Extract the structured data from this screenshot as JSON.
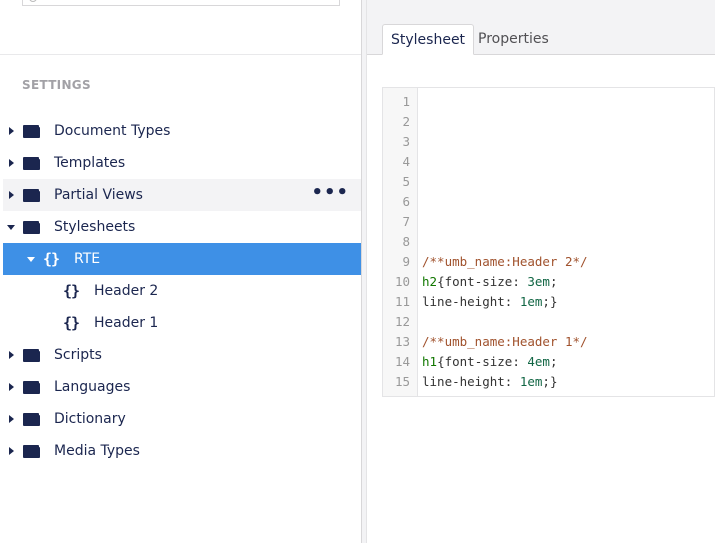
{
  "tree": {
    "section_title": "SETTINGS",
    "items": [
      {
        "label": "Document Types",
        "expand": "collapsed",
        "icon": "folder-icon"
      },
      {
        "label": "Templates",
        "expand": "collapsed",
        "icon": "folder-icon"
      },
      {
        "label": "Partial Views",
        "expand": "collapsed",
        "icon": "folder-icon",
        "hovered": true,
        "actions": "•••"
      },
      {
        "label": "Stylesheets",
        "expand": "expanded",
        "icon": "folder-icon"
      },
      {
        "label": "RTE",
        "expand": "expanded",
        "icon": "braces-icon",
        "selected": true,
        "icon_text": "{}"
      },
      {
        "label": "Header 2",
        "icon": "braces-icon",
        "icon_text": "{}"
      },
      {
        "label": "Header 1",
        "icon": "braces-icon",
        "icon_text": "{}"
      },
      {
        "label": "Scripts",
        "expand": "collapsed",
        "icon": "folder-icon"
      },
      {
        "label": "Languages",
        "expand": "collapsed",
        "icon": "folder-icon"
      },
      {
        "label": "Dictionary",
        "expand": "collapsed",
        "icon": "folder-icon"
      },
      {
        "label": "Media Types",
        "expand": "collapsed",
        "icon": "folder-icon"
      }
    ]
  },
  "editor": {
    "tabs": [
      {
        "label": "Stylesheet",
        "active": true
      },
      {
        "label": "Properties",
        "active": false
      }
    ],
    "lines": [
      {
        "n": "1",
        "text": ""
      },
      {
        "n": "2",
        "text": ""
      },
      {
        "n": "3",
        "text": ""
      },
      {
        "n": "4",
        "text": ""
      },
      {
        "n": "5",
        "text": ""
      },
      {
        "n": "6",
        "text": ""
      },
      {
        "n": "7",
        "text": ""
      },
      {
        "n": "8",
        "text": ""
      },
      {
        "n": "9",
        "comment": "/**umb_name:Header 2*/"
      },
      {
        "n": "10",
        "tag": "h2",
        "rest": "{font-size: ",
        "num": "3em",
        "tail": ";"
      },
      {
        "n": "11",
        "text": "line-height: ",
        "num": "1em",
        "tail": ";}"
      },
      {
        "n": "12",
        "text": ""
      },
      {
        "n": "13",
        "comment": "/**umb_name:Header 1*/"
      },
      {
        "n": "14",
        "tag": "h1",
        "rest": "{font-size: ",
        "num": "4em",
        "tail": ";"
      },
      {
        "n": "15",
        "text": "line-height: ",
        "num": "1em",
        "tail": ";}"
      }
    ]
  },
  "colors": {
    "accent": "#3e90e6",
    "text": "#1b264f",
    "comment": "#a0522d",
    "tag": "#117700"
  }
}
